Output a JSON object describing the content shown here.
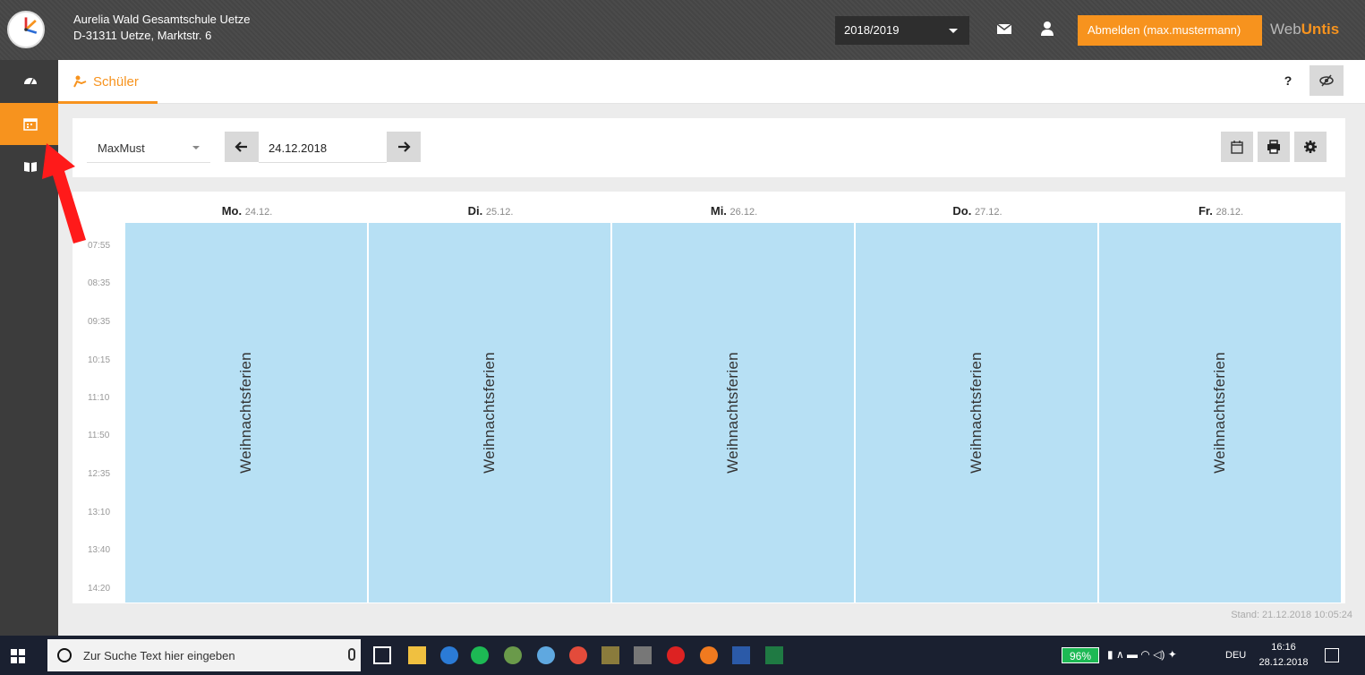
{
  "header": {
    "school_name": "Aurelia Wald Gesamtschule Uetze",
    "school_address": "D-31311 Uetze, Marktstr. 6",
    "school_year": "2018/2019",
    "logout_label": "Abmelden (max.mustermann)",
    "brand_web": "Web",
    "brand_untis": "Untis"
  },
  "tabs": [
    {
      "label": "Schüler"
    }
  ],
  "help_label": "?",
  "toolbar": {
    "student": "MaxMust",
    "date": "24.12.2018"
  },
  "timetable": {
    "days": [
      {
        "day": "Mo.",
        "date": "24.12.",
        "entry": "Weihnachtsferien"
      },
      {
        "day": "Di.",
        "date": "25.12.",
        "entry": "Weihnachtsferien"
      },
      {
        "day": "Mi.",
        "date": "26.12.",
        "entry": "Weihnachtsferien"
      },
      {
        "day": "Do.",
        "date": "27.12.",
        "entry": "Weihnachtsferien"
      },
      {
        "day": "Fr.",
        "date": "28.12.",
        "entry": "Weihnachtsferien"
      }
    ],
    "times": [
      "07:55",
      "08:35",
      "09:35",
      "10:15",
      "11:10",
      "11:50",
      "12:35",
      "13:10",
      "13:40",
      "14:20"
    ],
    "stand": "Stand: 21.12.2018 10:05:24"
  },
  "taskbar": {
    "search_placeholder": "Zur Suche Text hier eingeben",
    "battery": "96%",
    "language": "DEU",
    "time": "16:16",
    "date": "28.12.2018"
  },
  "colors": {
    "accent": "#f7931e",
    "holiday": "#b7e0f4",
    "rail": "#3c3c3c"
  }
}
